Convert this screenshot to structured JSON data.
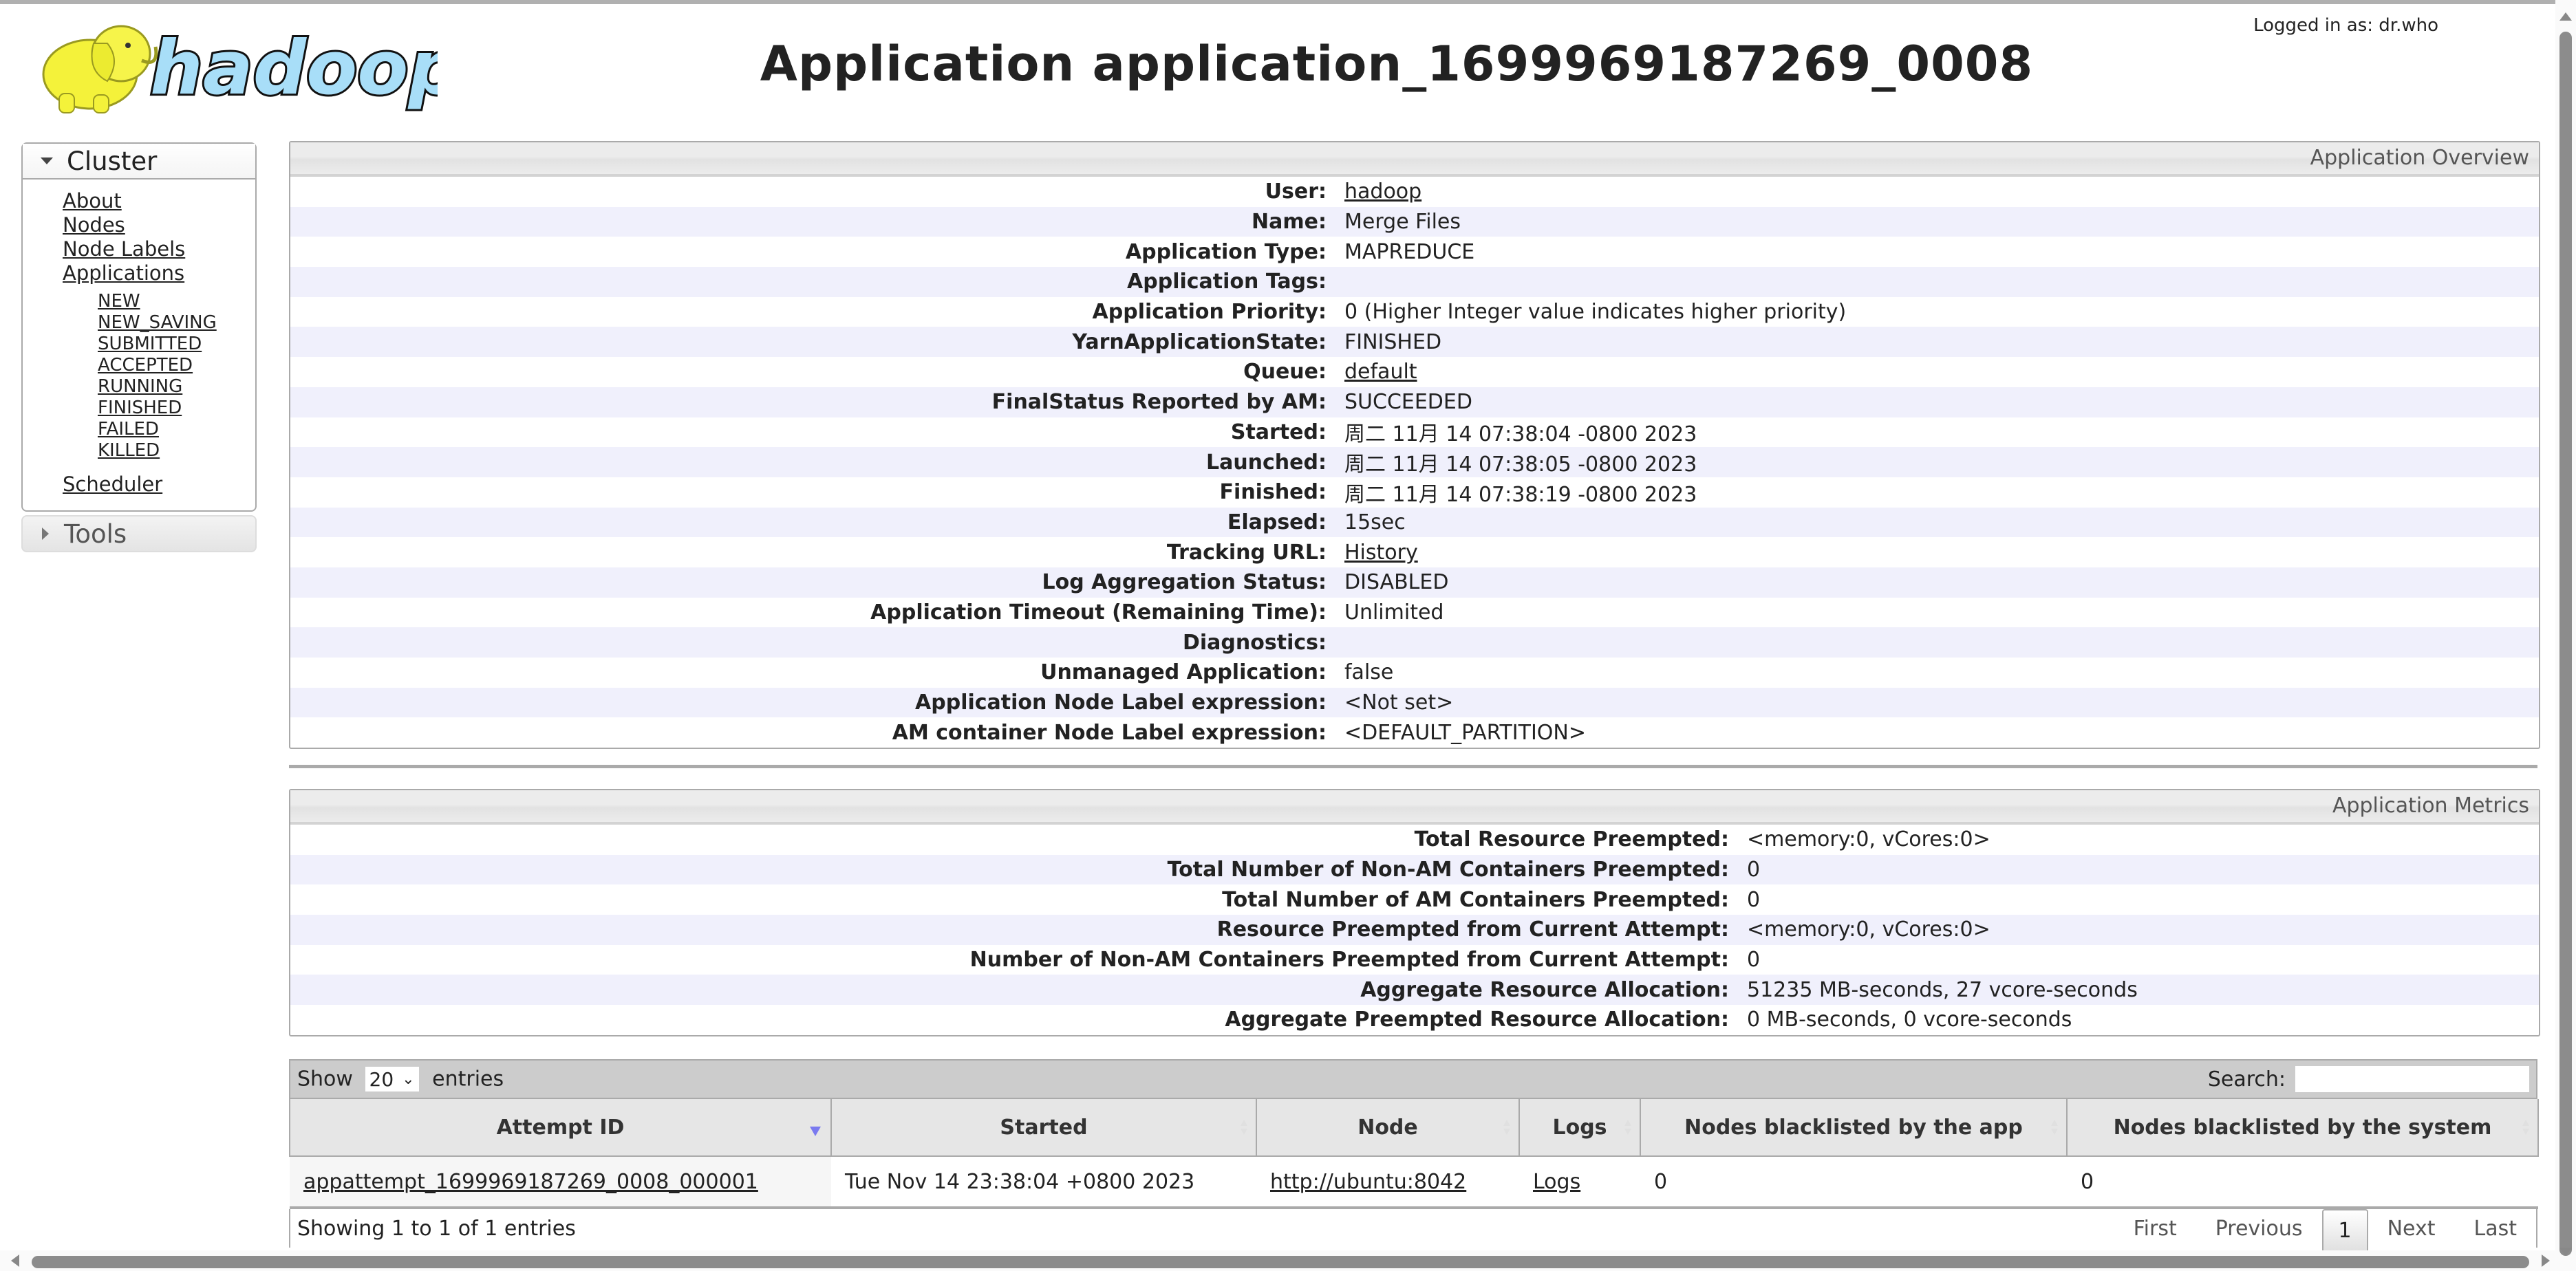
{
  "header": {
    "logo_text": "hadoop",
    "title": "Application application_1699969187269_0008",
    "logged_in": "Logged in as: dr.who"
  },
  "sidebar": {
    "cluster_label": "Cluster",
    "items": [
      {
        "label": "About"
      },
      {
        "label": "Nodes"
      },
      {
        "label": "Node Labels"
      },
      {
        "label": "Applications"
      }
    ],
    "app_states": [
      "NEW",
      "NEW_SAVING",
      "SUBMITTED",
      "ACCEPTED",
      "RUNNING",
      "FINISHED",
      "FAILED",
      "KILLED"
    ],
    "scheduler_label": "Scheduler",
    "tools_label": "Tools"
  },
  "overview": {
    "title": "Application Overview",
    "rows": [
      {
        "key": "User:",
        "value": "hadoop",
        "link": true
      },
      {
        "key": "Name:",
        "value": "Merge Files"
      },
      {
        "key": "Application Type:",
        "value": "MAPREDUCE"
      },
      {
        "key": "Application Tags:",
        "value": ""
      },
      {
        "key": "Application Priority:",
        "value": "0 (Higher Integer value indicates higher priority)"
      },
      {
        "key": "YarnApplicationState:",
        "value": "FINISHED"
      },
      {
        "key": "Queue:",
        "value": "default",
        "link": true
      },
      {
        "key": "FinalStatus Reported by AM:",
        "value": "SUCCEEDED"
      },
      {
        "key": "Started:",
        "value": "周二 11月 14 07:38:04 -0800 2023"
      },
      {
        "key": "Launched:",
        "value": "周二 11月 14 07:38:05 -0800 2023"
      },
      {
        "key": "Finished:",
        "value": "周二 11月 14 07:38:19 -0800 2023"
      },
      {
        "key": "Elapsed:",
        "value": "15sec"
      },
      {
        "key": "Tracking URL:",
        "value": "History",
        "link": true
      },
      {
        "key": "Log Aggregation Status:",
        "value": "DISABLED"
      },
      {
        "key": "Application Timeout (Remaining Time):",
        "value": "Unlimited"
      },
      {
        "key": "Diagnostics:",
        "value": ""
      },
      {
        "key": "Unmanaged Application:",
        "value": "false"
      },
      {
        "key": "Application Node Label expression:",
        "value": "<Not set>"
      },
      {
        "key": "AM container Node Label expression:",
        "value": "<DEFAULT_PARTITION>"
      }
    ]
  },
  "metrics": {
    "title": "Application Metrics",
    "rows": [
      {
        "key": "Total Resource Preempted:",
        "value": "<memory:0, vCores:0>"
      },
      {
        "key": "Total Number of Non-AM Containers Preempted:",
        "value": "0"
      },
      {
        "key": "Total Number of AM Containers Preempted:",
        "value": "0"
      },
      {
        "key": "Resource Preempted from Current Attempt:",
        "value": "<memory:0, vCores:0>"
      },
      {
        "key": "Number of Non-AM Containers Preempted from Current Attempt:",
        "value": "0"
      },
      {
        "key": "Aggregate Resource Allocation:",
        "value": "51235 MB-seconds, 27 vcore-seconds"
      },
      {
        "key": "Aggregate Preempted Resource Allocation:",
        "value": "0 MB-seconds, 0 vcore-seconds"
      }
    ]
  },
  "attempts": {
    "show_label": "Show",
    "entries_label": "entries",
    "page_size": "20",
    "search_label": "Search:",
    "search_value": "",
    "columns": [
      "Attempt ID",
      "Started",
      "Node",
      "Logs",
      "Nodes blacklisted by the app",
      "Nodes blacklisted by the system"
    ],
    "rows": [
      {
        "attempt_id": "appattempt_1699969187269_0008_000001",
        "started": "Tue Nov 14 23:38:04 +0800 2023",
        "node": "http://ubuntu:8042",
        "logs": "Logs",
        "blacklisted_app": "0",
        "blacklisted_system": "0"
      }
    ],
    "info": "Showing 1 to 1 of 1 entries",
    "pager": {
      "first": "First",
      "previous": "Previous",
      "current": "1",
      "next": "Next",
      "last": "Last"
    }
  }
}
